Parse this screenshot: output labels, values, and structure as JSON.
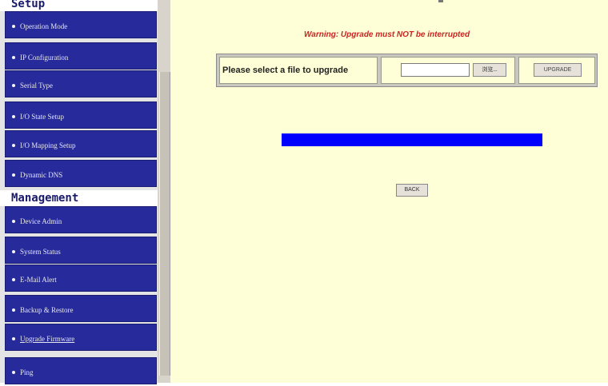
{
  "sidebar": {
    "section_setup": "Setup",
    "section_management": "Management",
    "setup_items": [
      {
        "label": "Operation Mode"
      },
      {
        "label": "IP Configuration"
      },
      {
        "label": "Serial Type"
      },
      {
        "label": "I/O State Setup"
      },
      {
        "label": "I/O Mapping Setup"
      },
      {
        "label": "Dynamic DNS"
      }
    ],
    "management_items": [
      {
        "label": "Device Admin"
      },
      {
        "label": "System Status"
      },
      {
        "label": "E-Mail Alert"
      },
      {
        "label": "Backup & Restore"
      },
      {
        "label": "Upgrade Firmware",
        "active": true
      },
      {
        "label": "Ping"
      }
    ]
  },
  "main": {
    "warning": "Warning: Upgrade must NOT be interrupted",
    "upgrade_form": {
      "prompt": "Please select a file to upgrade",
      "file_value": "",
      "browse_label": "浏览...",
      "upgrade_label": "UPGRADE"
    },
    "progress": {
      "fraction": 1.0
    },
    "back_label": "BACK"
  },
  "colors": {
    "nav_bg": "#262a9a",
    "content_bg": "#ffffd7",
    "warning": "#cc2222",
    "progress": "#0000ff",
    "heading": "#1a1a6e"
  }
}
